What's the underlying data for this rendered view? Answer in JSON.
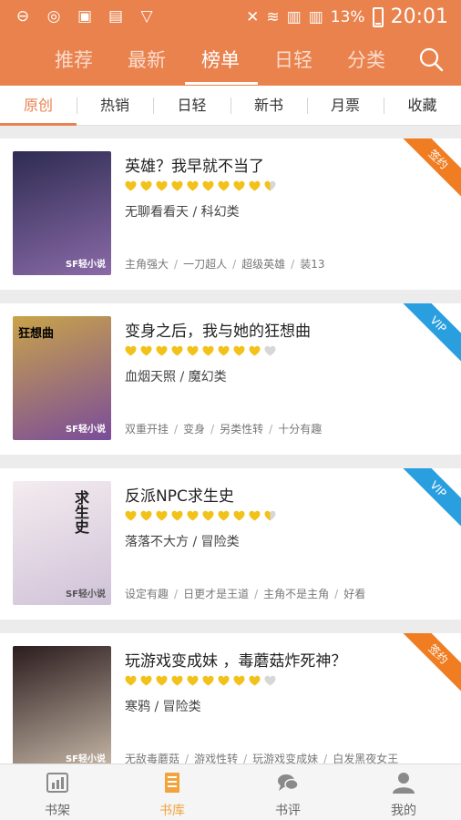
{
  "status_bar": {
    "battery_percent": "13%",
    "time": "20:01"
  },
  "top_tabs": [
    "推荐",
    "最新",
    "榜单",
    "日轻",
    "分类"
  ],
  "active_top_tab": "榜单",
  "sub_tabs": [
    "原创",
    "热销",
    "日轻",
    "新书",
    "月票",
    "收藏"
  ],
  "active_sub_tab": "原创",
  "books": [
    {
      "title": "英雄？我早就不当了",
      "author_category": "无聊看看天 / 科幻类",
      "tags": [
        "主角强大",
        "一刀超人",
        "超级英雄",
        "装13"
      ],
      "badge": "签约",
      "badge_color": "#f07d22",
      "rating_hearts": 9.5,
      "cover_colors": [
        "#2e2c52",
        "#8a6aa8"
      ],
      "cover_text": "SF轻小说"
    },
    {
      "title": "变身之后，我与她的狂想曲",
      "author_category": "血烟天照 / 魔幻类",
      "tags": [
        "双重开挂",
        "变身",
        "另类性转",
        "十分有趣"
      ],
      "badge": "VIP",
      "badge_color": "#2a9fe0",
      "rating_hearts": 9,
      "cover_colors": [
        "#c9a34a",
        "#7a4c9a"
      ],
      "cover_text": "SF轻小说",
      "cover_title": "狂想曲"
    },
    {
      "title": "反派NPC求生史",
      "author_category": "落落不大方 / 冒险类",
      "tags": [
        "设定有趣",
        "日更才是王道",
        "主角不是主角",
        "好看"
      ],
      "badge": "VIP",
      "badge_color": "#2a9fe0",
      "rating_hearts": 9.5,
      "cover_colors": [
        "#f4ecef",
        "#cfc2d8"
      ],
      "cover_text": "SF轻小说",
      "cover_title": "求生史"
    },
    {
      "title": "玩游戏变成妹 ，毒蘑菇炸死神？",
      "author_category": "寒鸦 / 冒险类",
      "tags": [
        "无敌毒蘑菇",
        "游戏性转",
        "玩游戏变成妹",
        "白发黑夜女王"
      ],
      "badge": "签约",
      "badge_color": "#f07d22",
      "rating_hearts": 9,
      "cover_colors": [
        "#2b1c1e",
        "#c7b8a8"
      ],
      "cover_text": "SF轻小说"
    }
  ],
  "bottom_nav": [
    "书架",
    "书库",
    "书评",
    "我的"
  ],
  "active_bottom_nav": "书库",
  "colors": {
    "accent": "#e9824d",
    "active_bottom": "#f1a43c",
    "heart": "#f2c21a"
  }
}
